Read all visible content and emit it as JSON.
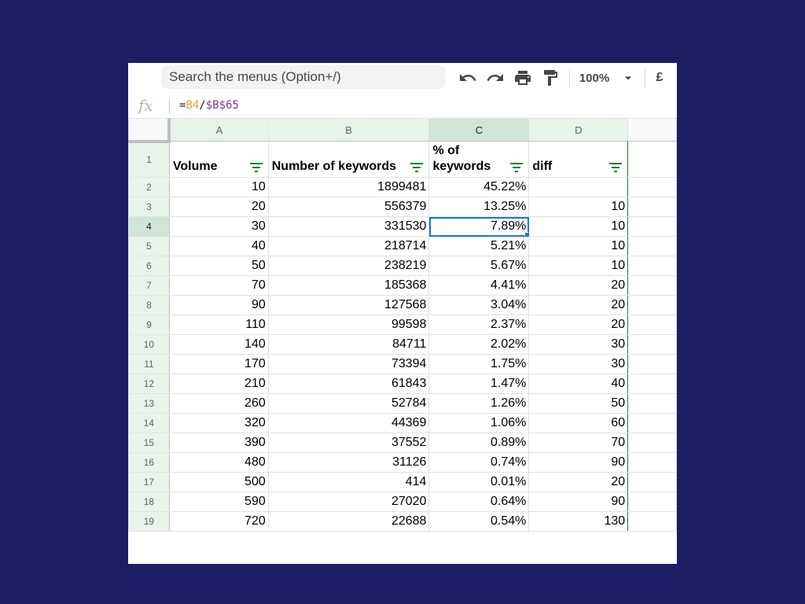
{
  "toolbar": {
    "search_placeholder": "Search the menus (Option+/)",
    "zoom": "100%",
    "currency": "£",
    "icons": [
      "undo-icon",
      "redo-icon",
      "print-icon",
      "paint-format-icon",
      "chevron-down-icon"
    ]
  },
  "formula_bar": {
    "fx_label": "fx",
    "formula_eq": "=",
    "formula_ref1": "B4",
    "formula_op": "/",
    "formula_ref2": "$B$65"
  },
  "grid": {
    "selected_cell": "C4",
    "column_headers": [
      "A",
      "B",
      "C",
      "D"
    ],
    "header_row": {
      "row_number": "1",
      "cells": [
        "Volume",
        "Number of keywords",
        "% of keywords",
        "diff"
      ]
    },
    "rows": [
      {
        "n": "2",
        "volume": "10",
        "keywords": "1899481",
        "percent": "45.22%",
        "diff": ""
      },
      {
        "n": "3",
        "volume": "20",
        "keywords": "556379",
        "percent": "13.25%",
        "diff": "10"
      },
      {
        "n": "4",
        "volume": "30",
        "keywords": "331530",
        "percent": "7.89%",
        "diff": "10"
      },
      {
        "n": "5",
        "volume": "40",
        "keywords": "218714",
        "percent": "5.21%",
        "diff": "10"
      },
      {
        "n": "6",
        "volume": "50",
        "keywords": "238219",
        "percent": "5.67%",
        "diff": "10"
      },
      {
        "n": "7",
        "volume": "70",
        "keywords": "185368",
        "percent": "4.41%",
        "diff": "20"
      },
      {
        "n": "8",
        "volume": "90",
        "keywords": "127568",
        "percent": "3.04%",
        "diff": "20"
      },
      {
        "n": "9",
        "volume": "110",
        "keywords": "99598",
        "percent": "2.37%",
        "diff": "20"
      },
      {
        "n": "10",
        "volume": "140",
        "keywords": "84711",
        "percent": "2.02%",
        "diff": "30"
      },
      {
        "n": "11",
        "volume": "170",
        "keywords": "73394",
        "percent": "1.75%",
        "diff": "30"
      },
      {
        "n": "12",
        "volume": "210",
        "keywords": "61843",
        "percent": "1.47%",
        "diff": "40"
      },
      {
        "n": "13",
        "volume": "260",
        "keywords": "52784",
        "percent": "1.26%",
        "diff": "50"
      },
      {
        "n": "14",
        "volume": "320",
        "keywords": "44369",
        "percent": "1.06%",
        "diff": "60"
      },
      {
        "n": "15",
        "volume": "390",
        "keywords": "37552",
        "percent": "0.89%",
        "diff": "70"
      },
      {
        "n": "16",
        "volume": "480",
        "keywords": "31126",
        "percent": "0.74%",
        "diff": "90"
      },
      {
        "n": "17",
        "volume": "500",
        "keywords": "414",
        "percent": "0.01%",
        "diff": "20"
      },
      {
        "n": "18",
        "volume": "590",
        "keywords": "27020",
        "percent": "0.64%",
        "diff": "90"
      },
      {
        "n": "19",
        "volume": "720",
        "keywords": "22688",
        "percent": "0.54%",
        "diff": "130"
      }
    ]
  },
  "colors": {
    "background": "#1e1c63",
    "filter_green": "#188038",
    "selection_blue": "#1a73e8",
    "header_green": "#e8f3ea"
  }
}
